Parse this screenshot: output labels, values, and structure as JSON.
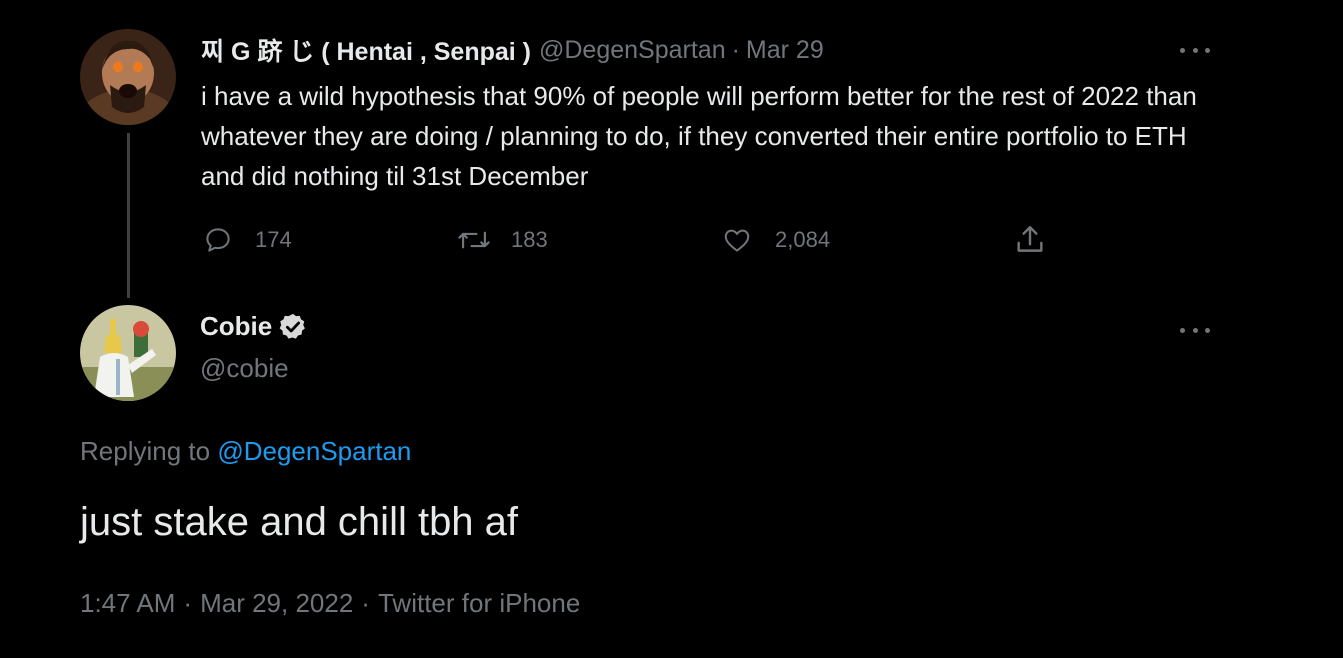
{
  "parent_tweet": {
    "author_name": "찌 G 跻 じ ( Hentai , Senpai )",
    "handle": "@DegenSpartan",
    "separator": "·",
    "date": "Mar 29",
    "text": "i have a wild hypothesis that 90% of people will perform better for the rest of 2022 than whatever they are doing / planning to do, if they converted their entire portfolio to ETH and did nothing til 31st December",
    "reply_count": "174",
    "retweet_count": "183",
    "like_count": "2,084"
  },
  "reply_tweet": {
    "author_name": "Cobie",
    "handle": "@cobie",
    "replying_label": "Replying to",
    "replying_to": "@DegenSpartan",
    "text": "just stake and chill tbh af",
    "time": "1:47 AM",
    "date": "Mar 29, 2022",
    "client": "Twitter for iPhone",
    "separator": "·"
  },
  "colors": {
    "background": "#000000",
    "text_primary": "#e7e9ea",
    "text_secondary": "#71767b",
    "link": "#1d9bf0",
    "thread_line": "#3e4144"
  },
  "icons": {
    "reply": "comment-icon",
    "retweet": "retweet-icon",
    "like": "heart-icon",
    "share": "share-icon",
    "more": "ellipsis-icon",
    "verified": "verified-badge-icon"
  }
}
